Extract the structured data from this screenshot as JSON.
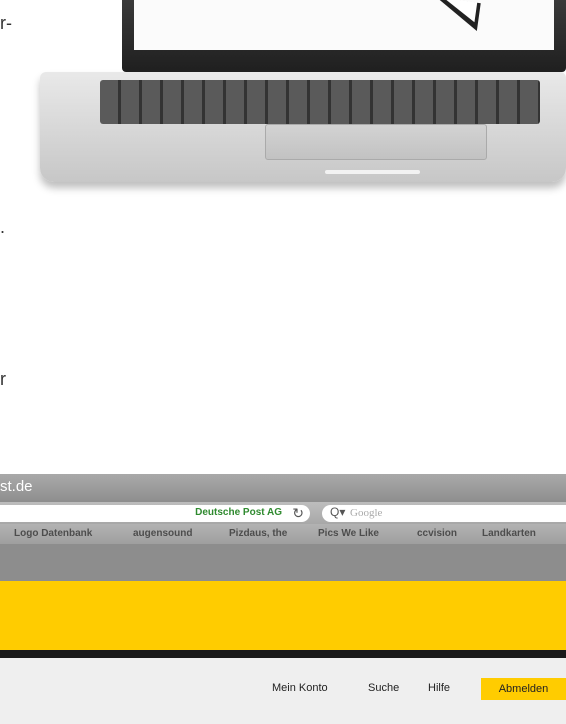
{
  "left_text_fragments": [
    "r-",
    ".",
    "r"
  ],
  "browser": {
    "window_title": "st.de",
    "addressbar": {
      "site_identity": "Deutsche Post AG",
      "reload_glyph": "↻",
      "search_icon_glyph": "Q▾",
      "search_placeholder": "Google"
    },
    "bookmarks": [
      "Logo Datenbank",
      "augensound",
      "Pizdaus, the",
      "Pics We Like",
      "ccvision",
      "Landkarten"
    ],
    "nav": {
      "links": [
        "Mein Konto",
        "Suche",
        "Hilfe"
      ],
      "logout_label": "Abmelden"
    }
  },
  "colors": {
    "brand_yellow": "#ffcc00",
    "site_identity_green": "#2f8a2f"
  }
}
